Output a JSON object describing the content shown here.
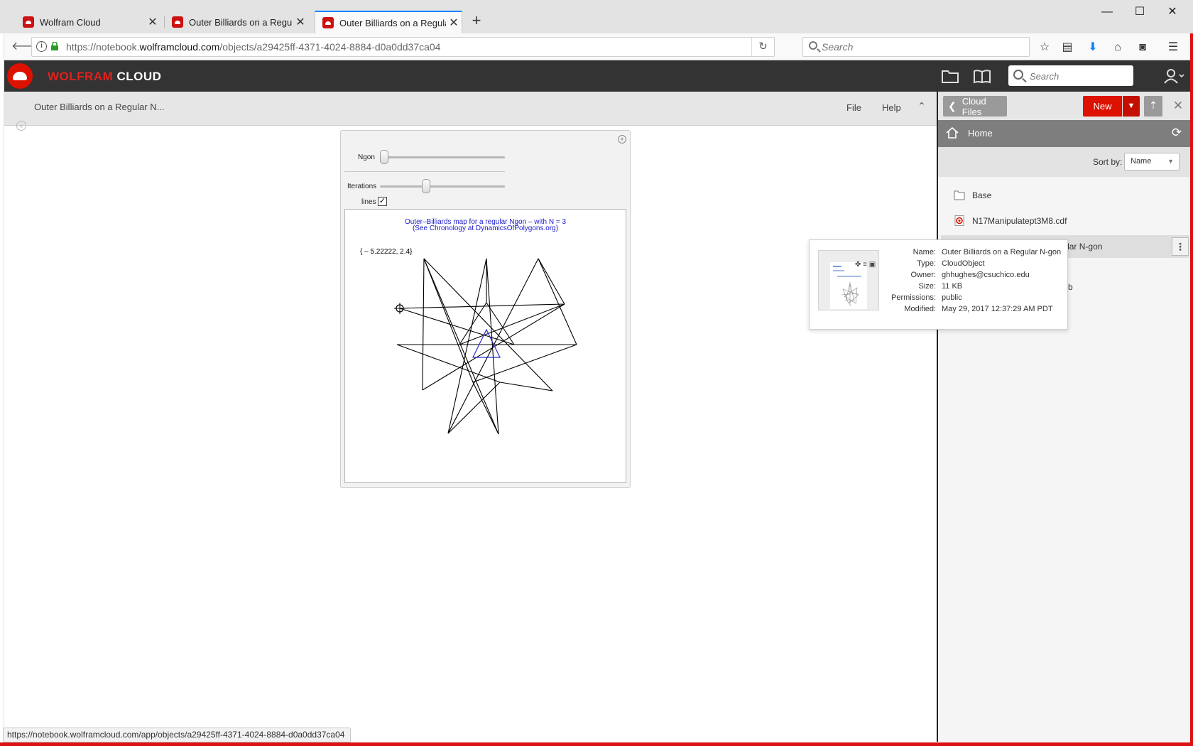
{
  "browser": {
    "tabs": [
      {
        "label": "Wolfram Cloud",
        "active": false
      },
      {
        "label": "Outer Billiards on a Regular N",
        "active": false
      },
      {
        "label": "Outer Billiards on a Regular N",
        "active": true
      }
    ],
    "new_tab": "+",
    "window_controls": {
      "minimize": "—",
      "maximize": "☐",
      "close": "✕"
    },
    "url_prefix": "https://notebook.",
    "url_domain": "wolframcloud.com",
    "url_path": "/objects/a29425ff-4371-4024-8884-d0a0dd37ca04",
    "search_placeholder": "Search",
    "accent_color": "#0a84ff",
    "status_url": "https://notebook.wolframcloud.com/app/objects/a29425ff-4371-4024-8884-d0a0dd37ca04"
  },
  "wolfram": {
    "brand_part1": "WOLFRAM",
    "brand_part2": "CLOUD",
    "brand_color": "#dd1100",
    "search_placeholder": "Search"
  },
  "notebook": {
    "title": "Outer Billiards on a Regular N...",
    "menu_file": "File",
    "menu_help": "Help"
  },
  "manipulate": {
    "ngon_label": "Ngon",
    "ngon_slider_fraction": 0.0,
    "iterations_label": "Iterations",
    "iterations_slider_fraction": 0.36,
    "lines_label": "lines",
    "lines_checked": true,
    "checkmark": "✓",
    "plot_title_line1": "Outer–Billiards map for a regular Ngon – with N = 3",
    "plot_title_line2": "(See Chronology at DynamicsOfPolygons.org)",
    "coordinate_readout": "{ – 5.22222,  2.4}"
  },
  "cloud_files": {
    "back_label": "Cloud Files",
    "new_label": "New",
    "home_label": "Home",
    "sort_label": "Sort by:",
    "sort_value": "Name",
    "items": [
      {
        "label": "Base",
        "icon": "folder-icon"
      },
      {
        "label": "N17Manipulatept3M8.cdf",
        "icon": "cdf-file-icon"
      },
      {
        "label": "Outer Billiards on a Regular N-gon",
        "icon": "notebook-icon",
        "selected": true
      }
    ],
    "peek_text": "b"
  },
  "file_info": {
    "rows": [
      {
        "key": "Name:",
        "value": "Outer Billiards on a Regular N-gon"
      },
      {
        "key": "Type:",
        "value": "CloudObject"
      },
      {
        "key": "Owner:",
        "value": "ghhughes@csuchico.edu"
      },
      {
        "key": "Size:",
        "value": "11 KB"
      },
      {
        "key": "Permissions:",
        "value": "public"
      },
      {
        "key": "Modified:",
        "value": "May 29, 2017   12:37:29 AM PDT"
      }
    ]
  }
}
